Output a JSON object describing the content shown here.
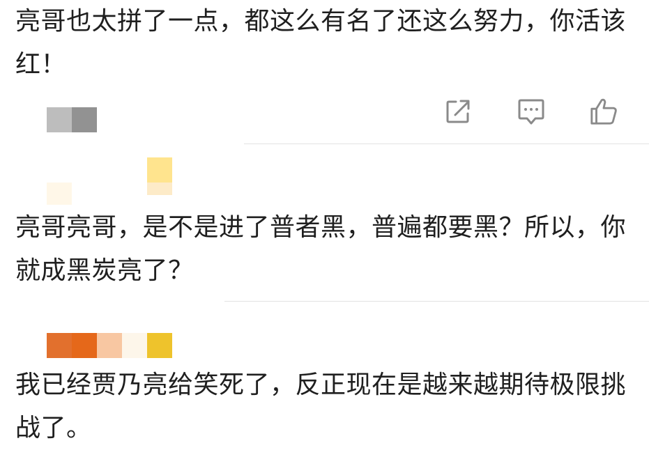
{
  "comments": [
    {
      "text": "亮哥也太拼了一点，都这么有名了还这么努力，你活该红！",
      "avatar_colors": [
        "#bdbdbd",
        "#929292"
      ],
      "actions": [
        {
          "name": "share",
          "icon": "share-icon"
        },
        {
          "name": "reply",
          "icon": "comment-icon"
        },
        {
          "name": "like",
          "icon": "thumbs-up-icon"
        }
      ]
    },
    {
      "text": "亮哥亮哥，是不是进了普者黑，普遍都要黑？所以，你就成黑炭亮了？",
      "avatar_colors": [
        "#fff7e8",
        "#ffe48e",
        "#fdebc8"
      ]
    },
    {
      "text": "我已经贾乃亮给笑死了，反正现在是越来越期待极限挑战了。",
      "avatar_colors": [
        "#e2702d",
        "#e5681a",
        "#f8c7a2",
        "#fdf6ea",
        "#eec32c"
      ]
    }
  ],
  "colors": {
    "text": "#1f1f1f",
    "icon": "#8a8a8a",
    "divider": "#e2e2e2"
  }
}
